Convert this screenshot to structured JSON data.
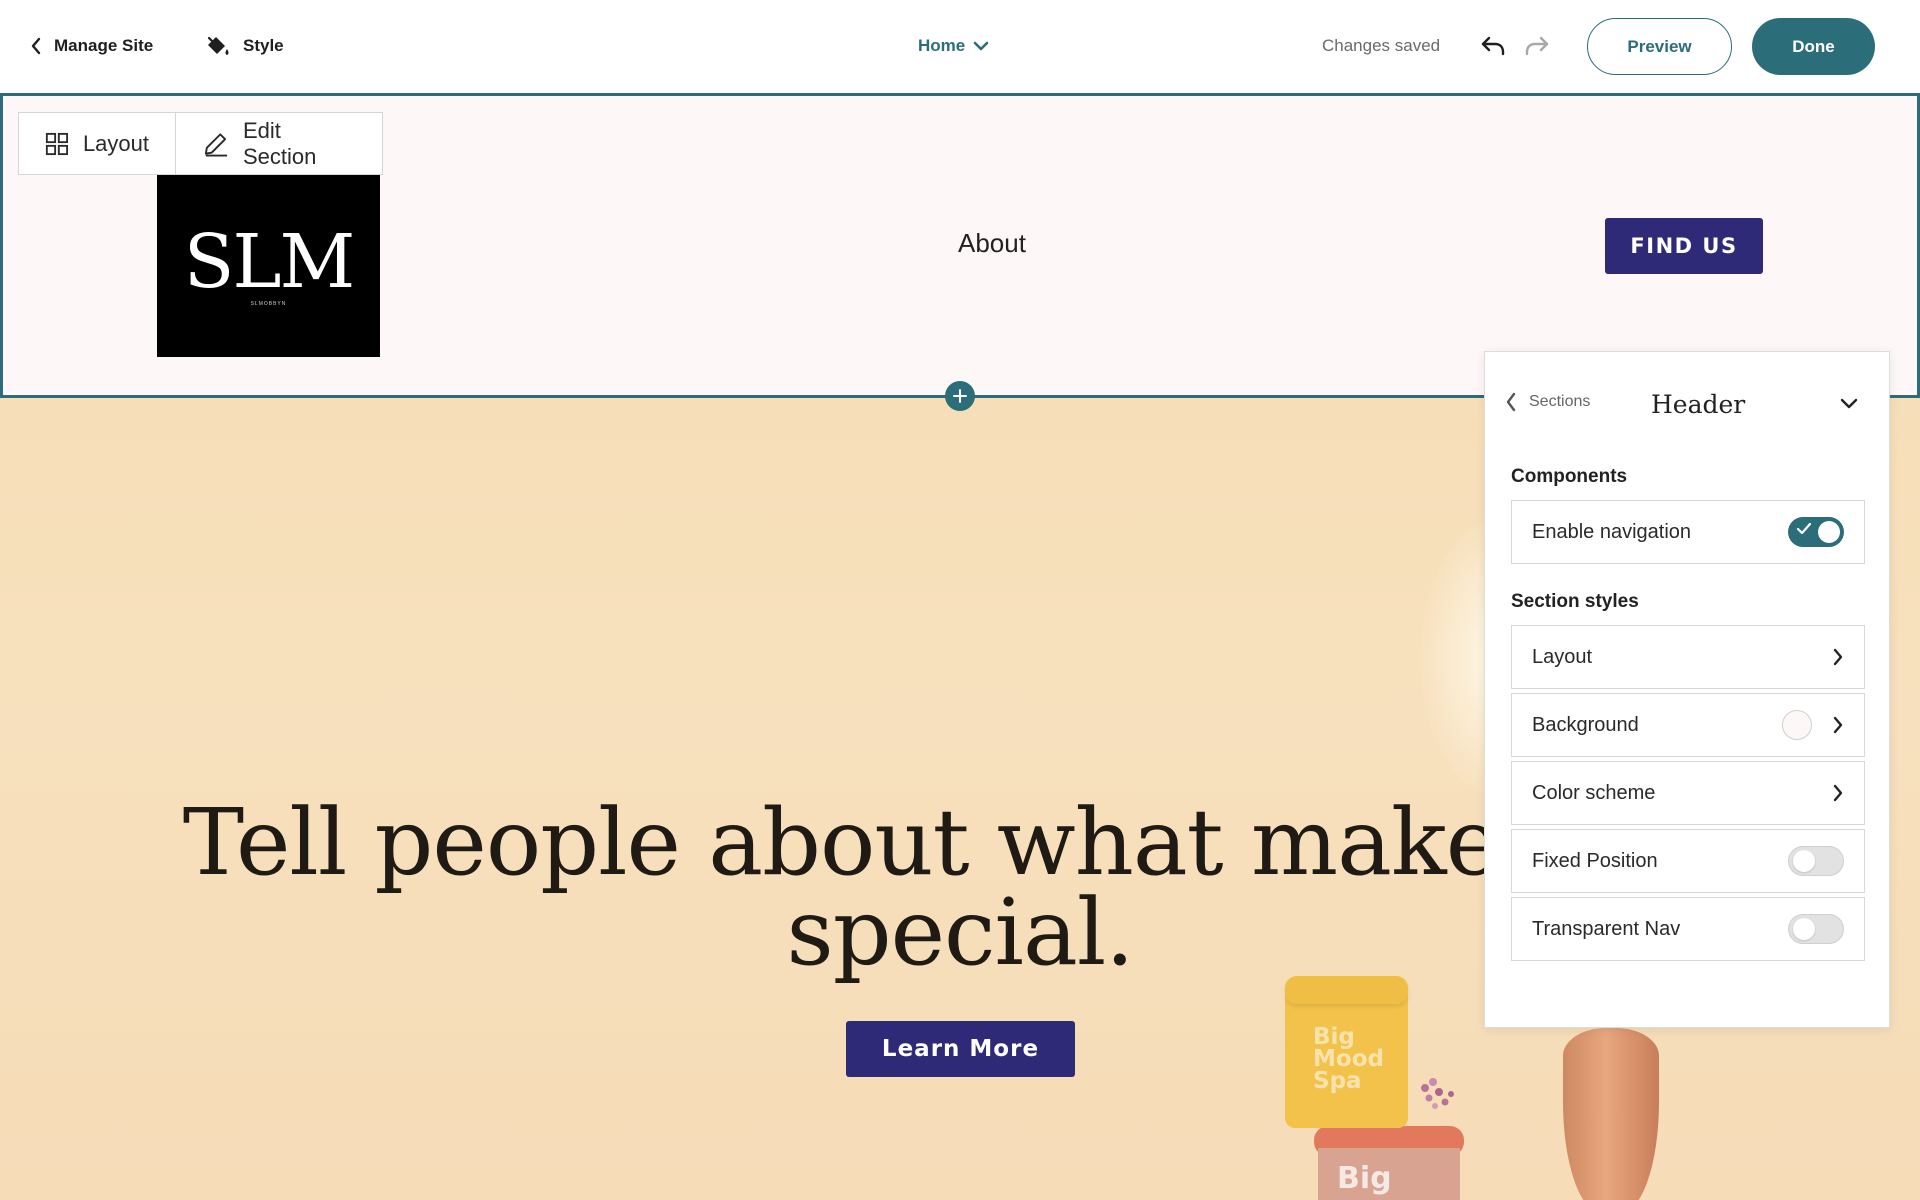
{
  "toolbar": {
    "manage_site": "Manage Site",
    "style": "Style",
    "page_select": "Home",
    "status": "Changes saved",
    "preview": "Preview",
    "done": "Done"
  },
  "section_toolbar": {
    "layout": "Layout",
    "edit_section": "Edit Section"
  },
  "site_header": {
    "logo_text": "SLM",
    "logo_subtext": "SLMOBBYN",
    "nav_items": [
      "About"
    ],
    "cta": "FIND US"
  },
  "hero": {
    "title": "Tell people about what makes you special.",
    "button": "Learn More",
    "jar1_label": "Big Mood Spa",
    "jar2_label": "Big"
  },
  "panel": {
    "back_label": "Sections",
    "title": "Header",
    "components_heading": "Components",
    "enable_navigation": "Enable navigation",
    "enable_navigation_on": true,
    "section_styles_heading": "Section styles",
    "layout": "Layout",
    "background": "Background",
    "color_scheme": "Color scheme",
    "fixed_position": "Fixed Position",
    "fixed_position_on": false,
    "transparent_nav": "Transparent Nav",
    "transparent_nav_on": false
  },
  "colors": {
    "accent": "#2b6d78",
    "cta_navy": "#2e2a78",
    "header_bg": "#fdf7f8",
    "hero_bg": "#f6dfb8"
  },
  "icons": [
    "chevron-left-icon",
    "paint-bucket-icon",
    "chevron-down-icon",
    "undo-icon",
    "redo-icon",
    "grid-layout-icon",
    "pencil-icon",
    "plus-icon",
    "chevron-right-icon",
    "check-icon"
  ]
}
